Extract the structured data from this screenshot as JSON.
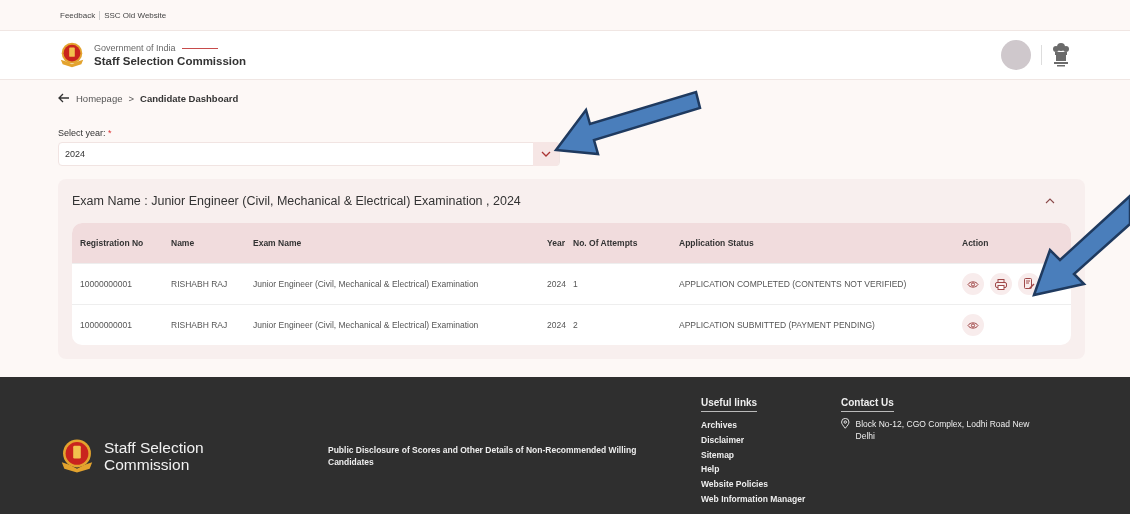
{
  "top_links": [
    "Feedback",
    "SSC Old Website"
  ],
  "header": {
    "subtitle": "Government of India",
    "title": "Staff Selection Commission"
  },
  "breadcrumb": {
    "items": [
      "Homepage",
      "Candidate Dashboard"
    ],
    "separator": ">"
  },
  "year_select": {
    "label": "Select year:",
    "required": "*",
    "value": "2024"
  },
  "exam_card": {
    "title": "Exam Name : Junior Engineer (Civil, Mechanical & Electrical) Examination , 2024",
    "expanded": true,
    "columns": [
      "Registration No",
      "Name",
      "Exam Name",
      "Year",
      "No. Of Attempts",
      "Application Status",
      "Action"
    ],
    "rows": [
      {
        "cells": [
          "10000000001",
          "RISHABH RAJ",
          "Junior Engineer (Civil, Mechanical & Electrical) Examination",
          "2024",
          "1",
          "APPLICATION COMPLETED (CONTENTS NOT VERIFIED)"
        ],
        "actions": [
          {
            "kind": "view"
          },
          {
            "kind": "print"
          },
          {
            "kind": "edit"
          }
        ]
      },
      {
        "cells": [
          "10000000001",
          "RISHABH RAJ",
          "Junior Engineer (Civil, Mechanical & Electrical) Examination",
          "2024",
          "2",
          "APPLICATION SUBMITTED (PAYMENT PENDING)"
        ],
        "actions": [
          {
            "kind": "view"
          }
        ]
      }
    ]
  },
  "footer": {
    "brand": "Staff Selection Commission",
    "disclosure": "Public Disclosure of Scores and Other Details of Non-Recommended Willing Candidates",
    "useful_links": {
      "heading": "Useful links",
      "items": [
        "Archives",
        "Disclaimer",
        "Sitemap",
        "Help",
        "Website Policies",
        "Web Information Manager"
      ]
    },
    "contact": {
      "heading": "Contact Us",
      "address": "Block No-12, CGO Complex, Lodhi Road New Delhi"
    }
  }
}
